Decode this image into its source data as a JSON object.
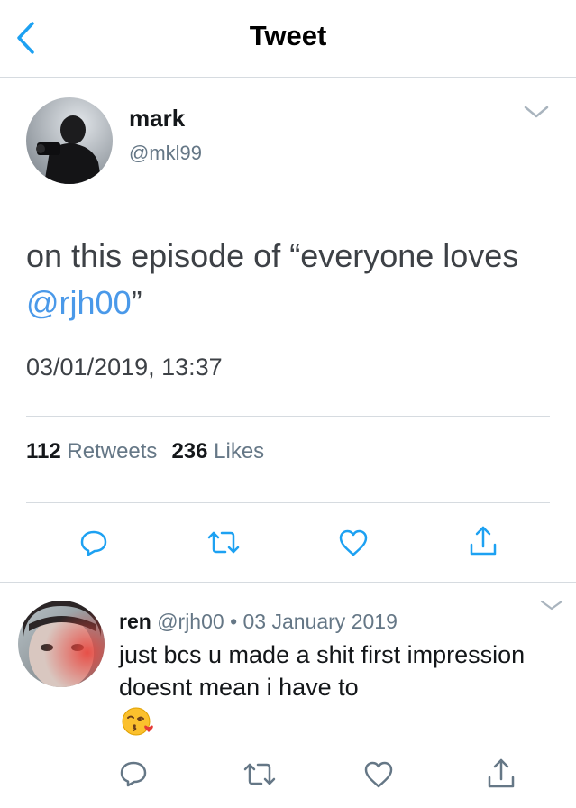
{
  "header": {
    "title": "Tweet"
  },
  "tweet": {
    "author_name": "mark",
    "author_handle": "@mkl99",
    "text_before": "on this episode of “everyone loves ",
    "mention": "@rjh00",
    "text_after": "”",
    "timestamp": "03/01/2019, 13:37",
    "retweet_count": "112",
    "retweet_label": "Retweets",
    "like_count": "236",
    "like_label": "Likes"
  },
  "reply": {
    "author_name": "ren",
    "meta": "@rjh00 • 03 January 2019",
    "text": "just bcs u made a shit first impression doesnt mean i have to",
    "emoji": "face-blowing-a-kiss"
  },
  "colors": {
    "link": "#4a99e9",
    "muted": "#657786",
    "icon": "#1da1f2",
    "divider": "#d6dbe0"
  }
}
